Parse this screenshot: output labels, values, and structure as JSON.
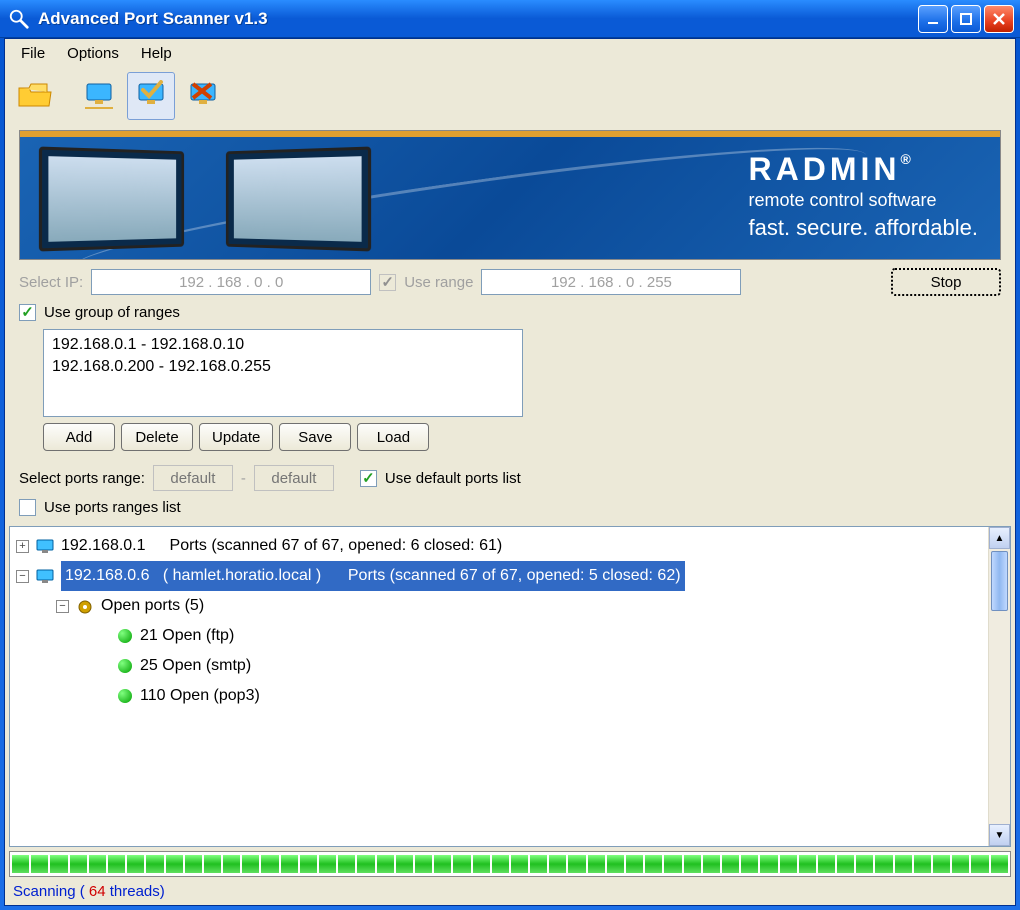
{
  "title": "Advanced Port Scanner v1.3",
  "menu": {
    "file": "File",
    "options": "Options",
    "help": "Help"
  },
  "toolbar": {
    "items": [
      "open-folder",
      "network-small",
      "network-check",
      "network-delete"
    ]
  },
  "banner": {
    "brand": "RADMIN",
    "sub1": "remote control software",
    "sub2": "fast. secure. affordable."
  },
  "ip_section": {
    "select_ip_label": "Select IP:",
    "ip_from": "192  .  168  .    0   .    0",
    "use_range_label": "Use range",
    "use_range_checked": true,
    "ip_to": "192  .  168  .    0   .  255",
    "stop_btn": "Stop"
  },
  "group_section": {
    "use_group_label": "Use group of ranges",
    "use_group_checked": true,
    "ranges": [
      "192.168.0.1 - 192.168.0.10",
      "192.168.0.200 - 192.168.0.255"
    ],
    "btns": {
      "add": "Add",
      "delete": "Delete",
      "update": "Update",
      "save": "Save",
      "load": "Load"
    }
  },
  "ports_section": {
    "label": "Select ports range:",
    "from_placeholder": "default",
    "to_placeholder": "default",
    "use_default_label": "Use default ports list",
    "use_default_checked": true,
    "use_ranges_list_label": "Use ports ranges list",
    "use_ranges_list_checked": false
  },
  "tree": {
    "hosts": [
      {
        "ip": "192.168.0.1",
        "name": "",
        "summary": "Ports (scanned 67 of 67, opened: 6 closed: 61)",
        "expanded": false,
        "selected": false
      },
      {
        "ip": "192.168.0.6",
        "name": "hamlet.horatio.local",
        "summary": "Ports (scanned 67 of 67, opened: 5 closed: 62)",
        "expanded": true,
        "selected": true,
        "open_label": "Open ports (5)",
        "ports": [
          "21 Open (ftp)",
          "25 Open (smtp)",
          "110 Open (pop3)"
        ]
      }
    ]
  },
  "status": {
    "prefix": "Scanning ( ",
    "threads": "64",
    "suffix": " threads)"
  }
}
